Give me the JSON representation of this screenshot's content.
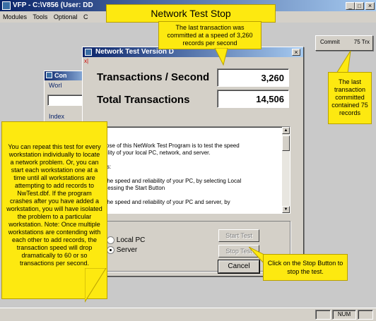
{
  "app": {
    "title": "VFP - C:\\V856 (User: DD",
    "menu": [
      "Modules",
      "Tools",
      "Optional",
      "C"
    ],
    "window_controls": {
      "min": "_",
      "max": "□",
      "close": "×"
    }
  },
  "stop_banner": "Network Test Stop",
  "callout_top": "The last transaction was committed at a speed of 3,260 records per second",
  "commit_panel": {
    "label": "Commit",
    "value": "75 Trx"
  },
  "callout_right": "The last transaction committed contained 75 records",
  "dialog": {
    "title": "Network Test Version D",
    "close": "×",
    "tps_label": "Transactions / Second",
    "tps_value": "3,260",
    "total_label": "Total Transactions",
    "total_value": "14,506",
    "textbox_lines": [
      "ose:",
      "",
      "purpose of this NetWork Test Program is to test the speed",
      "eliability of your local PC, network, and server.",
      "",
      "ctions:",
      "",
      "test the speed and reliability of your PC, by selecting Local",
      "nd pressing the Start Button",
      "",
      "test the speed and reliability of your PC and server, by"
    ],
    "radio_local": "Local PC",
    "radio_server": "Server",
    "start_button": "Start Test",
    "stop_button": "Stop Test",
    "cancel_button": "Cancel"
  },
  "bg_window": {
    "title": "Con",
    "tab": "Worl",
    "label": "Index"
  },
  "callout_left": "You can repeat this test for every workstation individually to locate a network problem. Or, you can start each workstation one at a time until all workstations are attempting to add records to NwTest.dbf. If the program crashes after you have added a workstation, you will have isolated the problem to a particular workstation. Note: Once multiple workstations are contending with each other to add records, the transaction speed will drop dramatically to 60 or so transactions per second.",
  "callout_stop": "Click on the Stop Button to stop the test.",
  "statusbar": {
    "num": "NUM"
  }
}
